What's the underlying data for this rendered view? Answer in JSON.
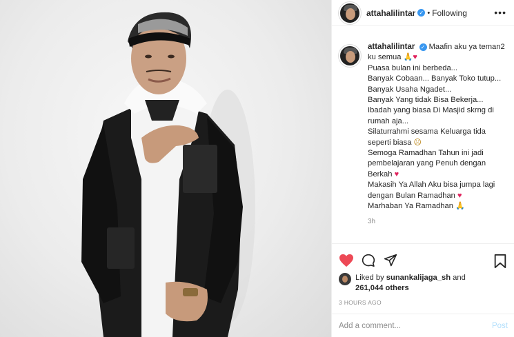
{
  "post": {
    "username": "attahalilintar",
    "follow_status": "Following",
    "more_label": "•••",
    "verified_glyph": "✓"
  },
  "caption": {
    "username": "attahalilintar",
    "lines": [
      "Maafin aku ya teman2 ku semua",
      "Puasa bulan ini berbeda...",
      "Banyak Cobaan... Banyak Toko tutup...",
      "Banyak Usaha Ngadet...",
      "Banyak Yang tidak Bisa Bekerja...",
      "Ibadah yang biasa Di Masjid skrng di rumah aja...",
      "Silaturrahmi sesama Keluarga tida seperti biasa",
      "Semoga Ramadhan Tahun ini jadi pembelajaran yang Penuh dengan Berkah",
      "Makasih Ya Allah Aku bisa jumpa lagi dengan Bulan Ramadhan",
      "Marhaban Ya Ramadhan"
    ],
    "emoji": {
      "pray": "🙏",
      "heart": "♥",
      "smile": "☹"
    },
    "age": "3h"
  },
  "actions": {
    "like_icon": "heart-filled-icon",
    "comment_icon": "comment-icon",
    "share_icon": "share-icon",
    "save_icon": "bookmark-icon",
    "like_color": "#ed4956"
  },
  "likes": {
    "prefix": "Liked by",
    "user": "sunankalijaga_sh",
    "and": "and",
    "count": "261,044 others"
  },
  "posted_time": "3 HOURS AGO",
  "comment": {
    "placeholder": "Add a comment...",
    "post_label": "Post"
  }
}
